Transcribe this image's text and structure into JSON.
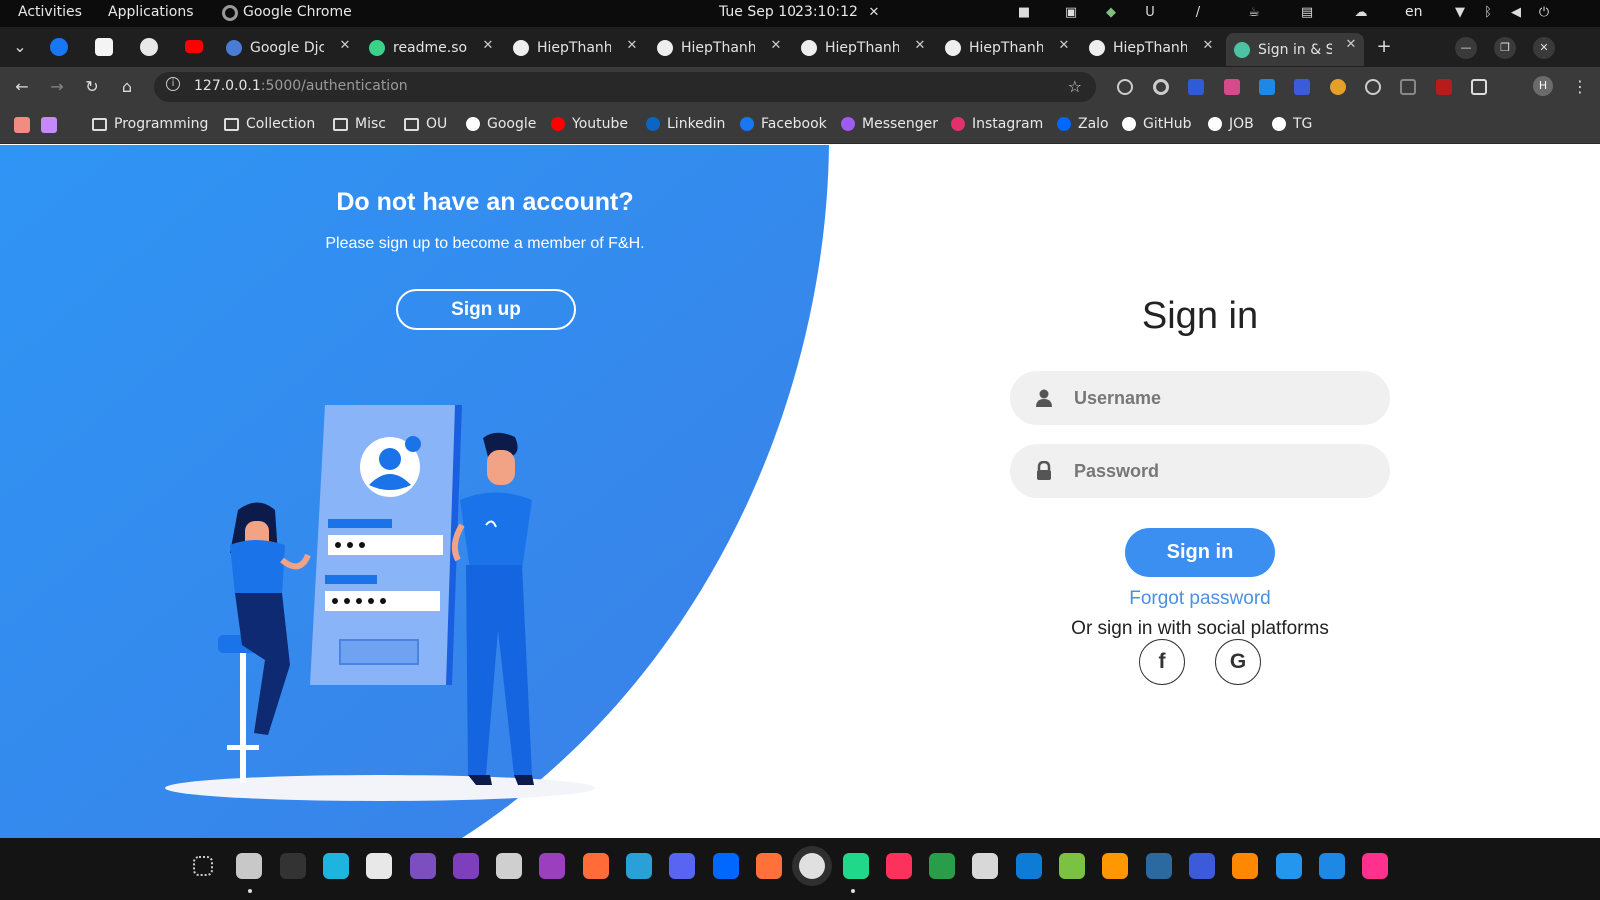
{
  "system_bar": {
    "activities": "Activities",
    "applications": "Applications",
    "focused_app": "Google Chrome",
    "date": "Tue Sep 10",
    "time": "23:10:12",
    "language": "en"
  },
  "tabs": [
    {
      "title": "Google Djc",
      "favicon_color": "#4a7bd6",
      "icon": "google-docs-icon"
    },
    {
      "title": "readme.so",
      "favicon_color": "#3bd18b",
      "icon": "readme-icon"
    },
    {
      "title": "HiepThanh",
      "favicon_color": "#eeeeee",
      "icon": "github-icon"
    },
    {
      "title": "HiepThanh",
      "favicon_color": "#eeeeee",
      "icon": "github-icon"
    },
    {
      "title": "HiepThanh",
      "favicon_color": "#eeeeee",
      "icon": "github-icon"
    },
    {
      "title": "HiepThanh",
      "favicon_color": "#eeeeee",
      "icon": "github-icon"
    },
    {
      "title": "HiepThanh",
      "favicon_color": "#eeeeee",
      "icon": "github-icon"
    },
    {
      "title": "Sign in & Si",
      "favicon_color": "#4dc3a6",
      "icon": "page-icon",
      "active": true
    }
  ],
  "address_bar": {
    "url_host": "127.0.0.1",
    "url_rest": ":5000/authentication"
  },
  "bookmarks": [
    {
      "label": "Programming",
      "icon": "folder-icon"
    },
    {
      "label": "Collection",
      "icon": "folder-icon"
    },
    {
      "label": "Misc",
      "icon": "folder-icon"
    },
    {
      "label": "OU",
      "icon": "folder-icon"
    },
    {
      "label": "Google",
      "icon": "google-icon"
    },
    {
      "label": "Youtube",
      "icon": "youtube-icon"
    },
    {
      "label": "Linkedin",
      "icon": "linkedin-icon"
    },
    {
      "label": "Facebook",
      "icon": "facebook-icon"
    },
    {
      "label": "Messenger",
      "icon": "messenger-icon"
    },
    {
      "label": "Instagram",
      "icon": "instagram-icon"
    },
    {
      "label": "Zalo",
      "icon": "zalo-icon"
    },
    {
      "label": "GitHub",
      "icon": "github-icon"
    },
    {
      "label": "JOB",
      "icon": "notion-icon"
    },
    {
      "label": "TG",
      "icon": "notion-icon"
    }
  ],
  "signup_panel": {
    "heading": "Do not have an account?",
    "text": "Please sign up to become a member of F&H.",
    "button": "Sign up",
    "bg_color": "#2f8af0"
  },
  "signin_form": {
    "title": "Sign in",
    "username_placeholder": "Username",
    "password_placeholder": "Password",
    "submit": "Sign in",
    "forgot": "Forgot password",
    "social_text": "Or sign in with social platforms",
    "social_facebook": "f",
    "social_google": "G",
    "accent": "#3a8ff0"
  },
  "dock_apps": [
    "app-grid-icon",
    "files-icon",
    "terminal-icon",
    "pycharm-icon",
    "notes-icon",
    "github-desktop-icon",
    "tor-icon",
    "database-icon",
    "infinity-icon",
    "postman-icon",
    "telegram-icon",
    "discord-icon",
    "zalo-icon",
    "firefox-icon",
    "chrome-icon",
    "pycharm-pro-icon",
    "intellij-icon",
    "anaconda-icon",
    "unity-icon",
    "vscode-icon",
    "minecraft-icon",
    "sublime-icon",
    "mysql-workbench-icon",
    "anki-icon",
    "vlc-icon",
    "docker-icon",
    "toolbox-icon",
    "jetbrains-icon"
  ]
}
